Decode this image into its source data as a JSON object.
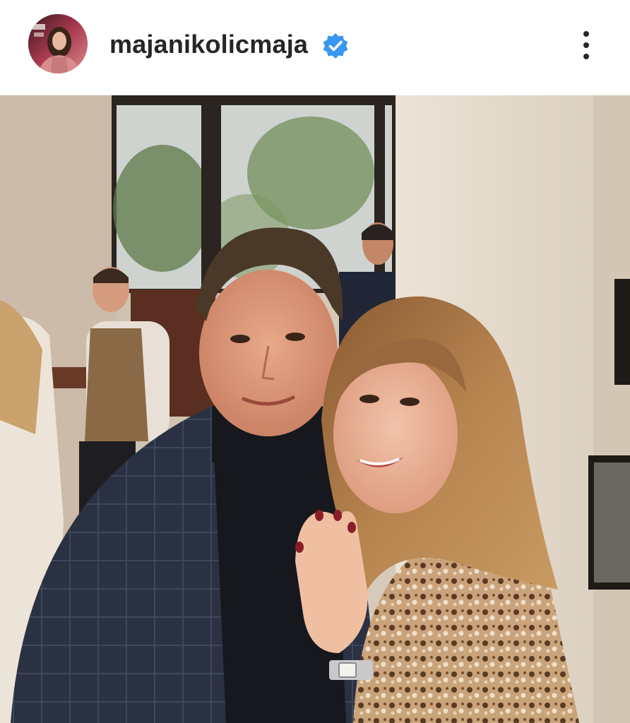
{
  "post": {
    "username": "majanikolicmaja",
    "verified": true,
    "avatar_icon": "profile-photo",
    "more_icon": "three-dots-vertical-icon",
    "image_description_icon": "post-photo"
  },
  "colors": {
    "username_text": "#262626",
    "verified_badge": "#3897f0",
    "background": "#ffffff"
  }
}
